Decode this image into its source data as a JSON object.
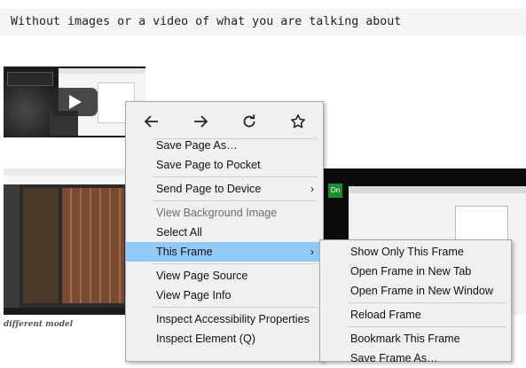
{
  "quote": {
    "text": "Without images or a video of what you are talking about"
  },
  "caption": {
    "text": "different model"
  },
  "thumb3": {
    "badge": "Dn"
  },
  "context_menu": {
    "nav_icons": [
      "back-arrow-icon",
      "forward-arrow-icon",
      "reload-icon",
      "bookmark-star-icon"
    ],
    "items": [
      {
        "label": "Save Page As…",
        "mnemonic_index": 5
      },
      {
        "label": "Save Page to Pocket",
        "mnemonic_index": 13
      },
      {
        "label": "Send Page to Device",
        "has_submenu": true
      },
      {
        "label": "View Background Image",
        "disabled": true
      },
      {
        "label": "Select All"
      },
      {
        "label": "This Frame",
        "has_submenu": true,
        "active": true
      },
      {
        "label": "View Page Source"
      },
      {
        "label": "View Page Info"
      },
      {
        "label": "Inspect Accessibility Properties"
      },
      {
        "label": "Inspect Element (Q)"
      }
    ],
    "submenu_arrow": "›"
  },
  "frame_submenu": {
    "items": [
      {
        "label": "Show Only This Frame"
      },
      {
        "label": "Open Frame in New Tab"
      },
      {
        "label": "Open Frame in New Window"
      },
      {
        "label": "Reload Frame"
      },
      {
        "label": "Bookmark This Frame"
      },
      {
        "label": "Save Frame As…"
      }
    ]
  },
  "colors": {
    "highlight": "#91c9f7",
    "menu_bg": "#f0f0f0",
    "disabled_text": "#6d6d6d"
  }
}
